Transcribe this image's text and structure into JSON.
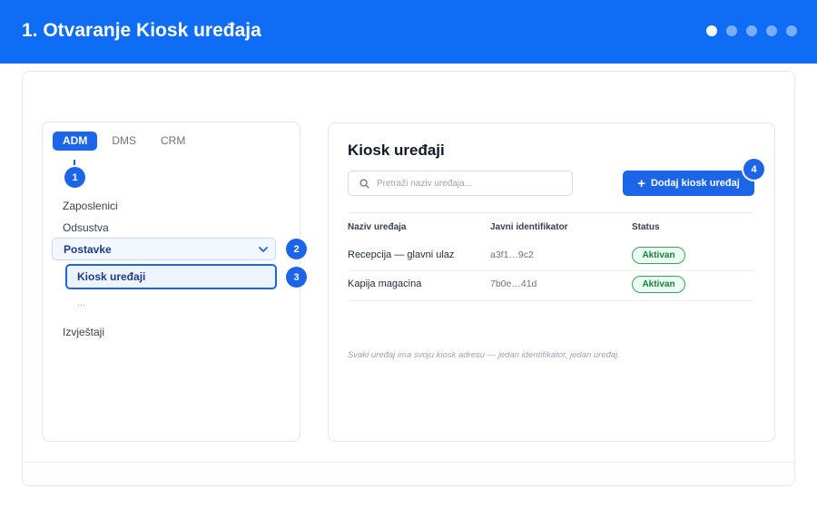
{
  "header": {
    "title": "1. Otvaranje Kiosk uređaja",
    "steps_total": 5,
    "active_step": 1
  },
  "tabs": [
    {
      "label": "ADM",
      "active": true
    },
    {
      "label": "DMS",
      "active": false
    },
    {
      "label": "CRM",
      "active": false
    }
  ],
  "sidebar": {
    "items": [
      {
        "label": "Zaposlenici"
      },
      {
        "label": "Odsustva"
      },
      {
        "label": "Postavke",
        "expanded": true
      },
      {
        "label": "Kiosk uređaji",
        "selected": true
      },
      {
        "label": "..."
      },
      {
        "label": "Izvještaji"
      }
    ]
  },
  "callouts": [
    "1",
    "2",
    "3",
    "4"
  ],
  "main": {
    "title": "Kiosk uređaji",
    "search_placeholder": "Pretraži naziv uređaja...",
    "add_button_label": "Dodaj kiosk uređaj",
    "columns": [
      "Naziv uređaja",
      "Javni identifikator",
      "Status"
    ],
    "rows": [
      {
        "name": "Recepcija — glavni ulaz",
        "id": "a3f1…9c2",
        "status": "Aktivan"
      },
      {
        "name": "Kapija magacina",
        "id": "7b0e…41d",
        "status": "Aktivan"
      }
    ],
    "footnote": "Svaki uređaj ima svoju kiosk adresu — jedan identifikator, jedan uređaj."
  },
  "colors": {
    "brand": "#0e6cf5",
    "accent": "#1d65e8",
    "status_active_border": "#34a853",
    "status_active_text": "#15803d"
  },
  "icons": [
    "search-icon",
    "chevron-down-icon",
    "plus-icon"
  ]
}
